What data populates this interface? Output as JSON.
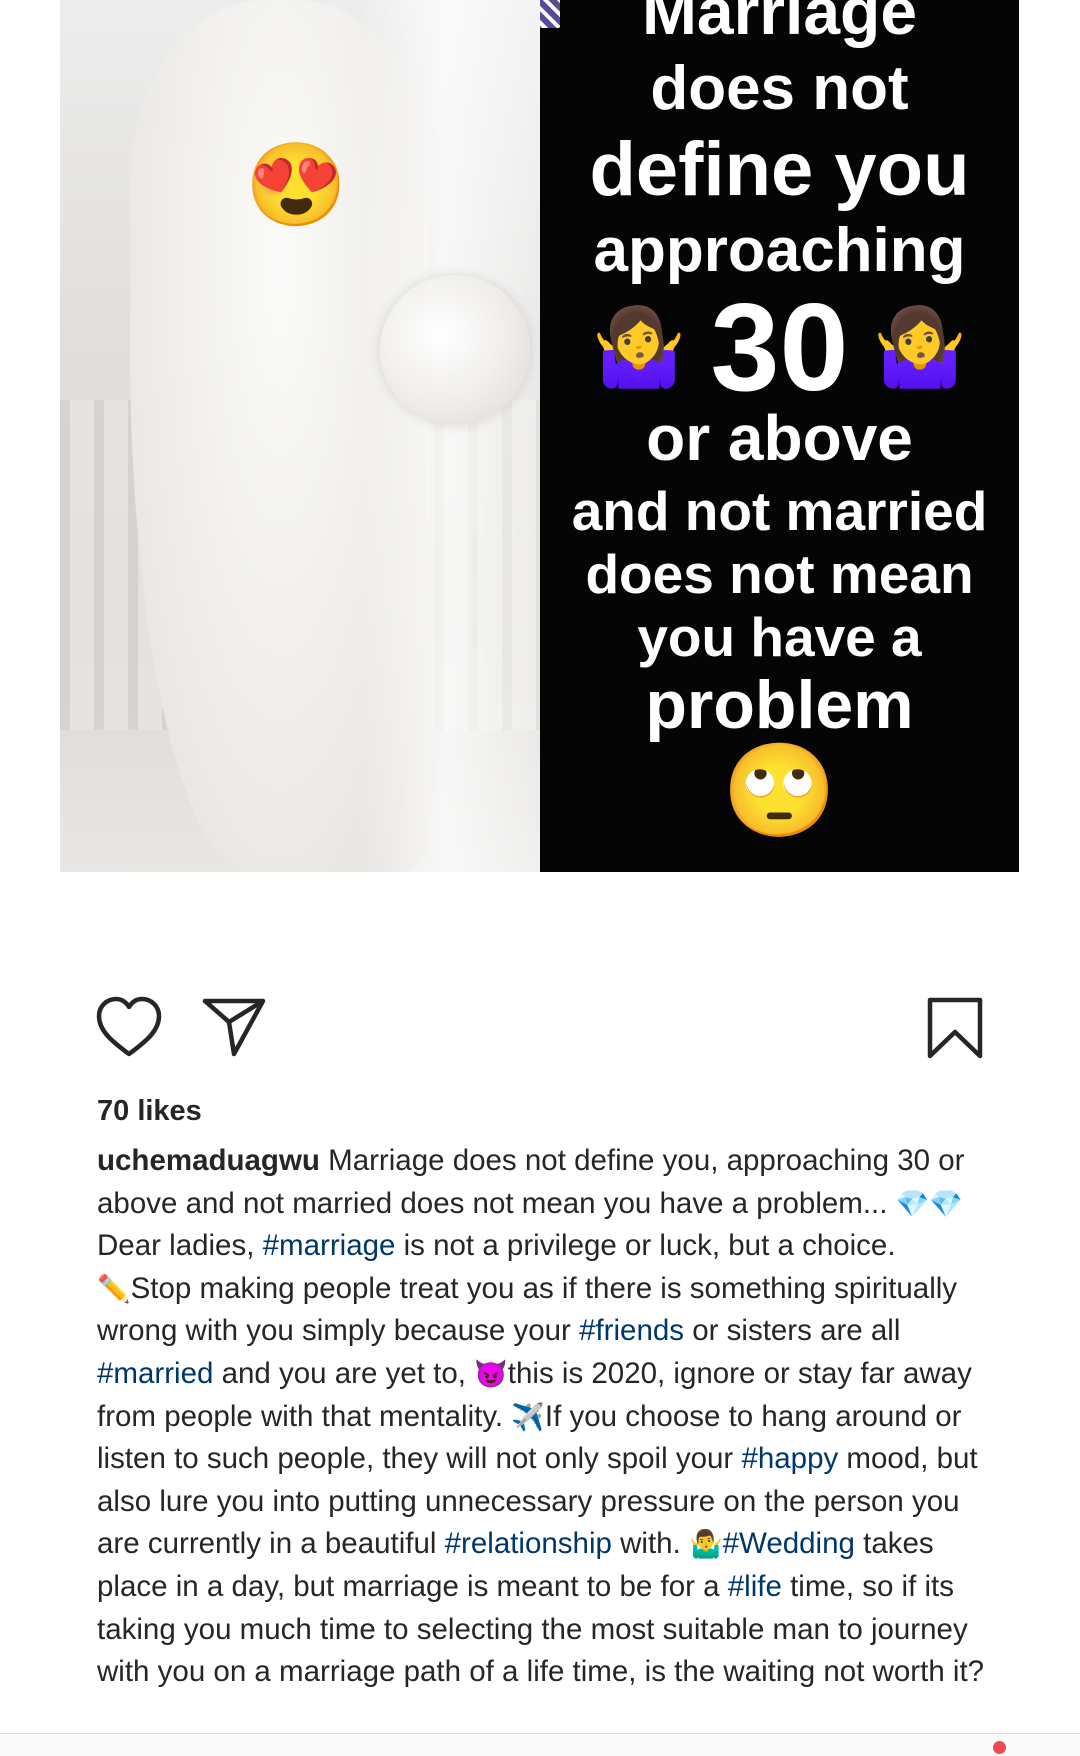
{
  "image": {
    "photo_emoji": "😍",
    "quote": {
      "line1": "Marriage",
      "line2": "does not",
      "line3": "define you",
      "line4": "approaching",
      "shrug_emoji": "🤷‍♀️",
      "number": "30",
      "line5": "or above",
      "line6": "and not married",
      "line7": "does not mean",
      "line8": "you have a",
      "line9": "problem",
      "end_emoji": "🙄"
    }
  },
  "actions": {
    "like_icon": "heart-outline",
    "share_icon": "paper-plane",
    "save_icon": "bookmark-outline"
  },
  "likes": "70 likes",
  "caption": {
    "username": "uchemaduagwu",
    "p1": " Marriage does not define you, approaching 30 or above and not married does not mean you have a problem... ",
    "e1": "💎💎",
    "p2": "Dear ladies, ",
    "t1": "#marriage",
    "p3": " is not a privilege or luck, but a choice. ",
    "e2": "✏️",
    "p4": "Stop making people treat you as if there is something spiritually wrong with you simply because your ",
    "t2": "#friends",
    "p5": " or sisters are all ",
    "t3": "#married",
    "p6": " and you are yet to, ",
    "e3": "😈",
    "p7": "this is 2020, ignore or stay far away from people with that mentality. ",
    "e4": "✈️",
    "p8": "If you choose to hang around or listen to such people, they will not only spoil your ",
    "t4": "#happy",
    "p9": " mood, but also lure you into putting unnecessary pressure on the person you are currently in a beautiful ",
    "t5": "#relationship",
    "p10": " with. ",
    "e5": "🤷‍♂️",
    "t6": "#Wedding",
    "p11": " takes place in a day, but marriage is meant to be for a ",
    "t7": "#life",
    "p12": " time, so if its taking you much time to selecting the most suitable man to journey with you on a marriage path of a life time, is the waiting not worth it?"
  },
  "colors": {
    "hashtag": "#00376b",
    "text": "#262626",
    "notification": "#ed4956"
  }
}
